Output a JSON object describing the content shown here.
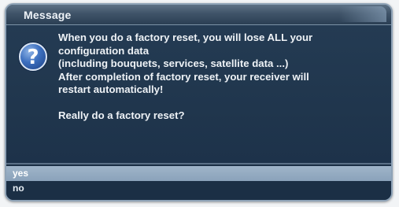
{
  "dialog": {
    "title": "Message",
    "icon": "question-icon",
    "icon_glyph": "?",
    "message_lines": [
      "When you do a factory reset, you will lose ALL your",
      "configuration data",
      "(including bouquets, services, satellite data ...)",
      "After completion of factory reset, your receiver will",
      "restart automatically!"
    ],
    "question": "Really do a factory reset?"
  },
  "options": [
    {
      "label": "yes",
      "selected": true
    },
    {
      "label": "no",
      "selected": false
    }
  ],
  "colors": {
    "dialog_background": "#1a2f45",
    "title_bar": "#3f5368",
    "selection_highlight": "#9fb4c9",
    "text": "#eef2f6",
    "icon_blue": "#3c6fbf"
  }
}
